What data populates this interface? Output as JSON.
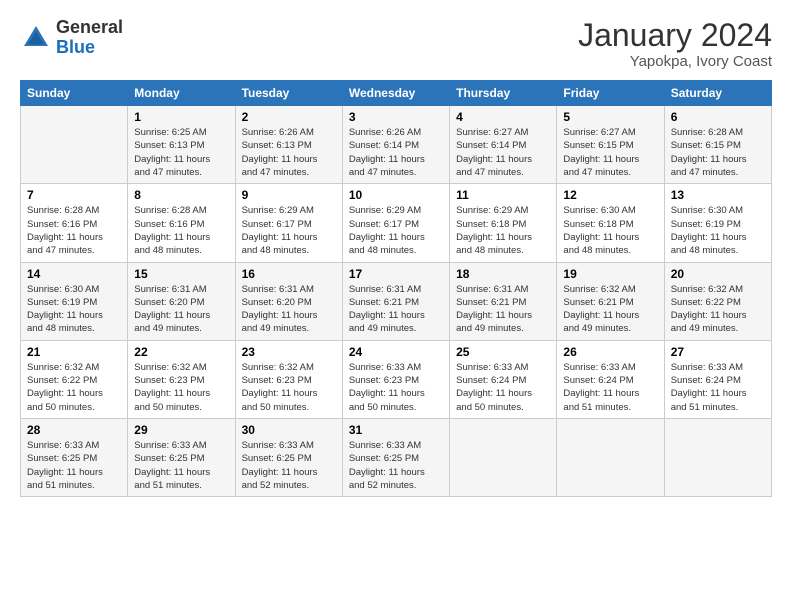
{
  "logo": {
    "line1": "General",
    "line2": "Blue"
  },
  "title": "January 2024",
  "subtitle": "Yapokpa, Ivory Coast",
  "weekdays": [
    "Sunday",
    "Monday",
    "Tuesday",
    "Wednesday",
    "Thursday",
    "Friday",
    "Saturday"
  ],
  "weeks": [
    [
      {
        "day": "",
        "sunrise": "",
        "sunset": "",
        "daylight": ""
      },
      {
        "day": "1",
        "sunrise": "Sunrise: 6:25 AM",
        "sunset": "Sunset: 6:13 PM",
        "daylight": "Daylight: 11 hours and 47 minutes."
      },
      {
        "day": "2",
        "sunrise": "Sunrise: 6:26 AM",
        "sunset": "Sunset: 6:13 PM",
        "daylight": "Daylight: 11 hours and 47 minutes."
      },
      {
        "day": "3",
        "sunrise": "Sunrise: 6:26 AM",
        "sunset": "Sunset: 6:14 PM",
        "daylight": "Daylight: 11 hours and 47 minutes."
      },
      {
        "day": "4",
        "sunrise": "Sunrise: 6:27 AM",
        "sunset": "Sunset: 6:14 PM",
        "daylight": "Daylight: 11 hours and 47 minutes."
      },
      {
        "day": "5",
        "sunrise": "Sunrise: 6:27 AM",
        "sunset": "Sunset: 6:15 PM",
        "daylight": "Daylight: 11 hours and 47 minutes."
      },
      {
        "day": "6",
        "sunrise": "Sunrise: 6:28 AM",
        "sunset": "Sunset: 6:15 PM",
        "daylight": "Daylight: 11 hours and 47 minutes."
      }
    ],
    [
      {
        "day": "7",
        "sunrise": "Sunrise: 6:28 AM",
        "sunset": "Sunset: 6:16 PM",
        "daylight": "Daylight: 11 hours and 47 minutes."
      },
      {
        "day": "8",
        "sunrise": "Sunrise: 6:28 AM",
        "sunset": "Sunset: 6:16 PM",
        "daylight": "Daylight: 11 hours and 48 minutes."
      },
      {
        "day": "9",
        "sunrise": "Sunrise: 6:29 AM",
        "sunset": "Sunset: 6:17 PM",
        "daylight": "Daylight: 11 hours and 48 minutes."
      },
      {
        "day": "10",
        "sunrise": "Sunrise: 6:29 AM",
        "sunset": "Sunset: 6:17 PM",
        "daylight": "Daylight: 11 hours and 48 minutes."
      },
      {
        "day": "11",
        "sunrise": "Sunrise: 6:29 AM",
        "sunset": "Sunset: 6:18 PM",
        "daylight": "Daylight: 11 hours and 48 minutes."
      },
      {
        "day": "12",
        "sunrise": "Sunrise: 6:30 AM",
        "sunset": "Sunset: 6:18 PM",
        "daylight": "Daylight: 11 hours and 48 minutes."
      },
      {
        "day": "13",
        "sunrise": "Sunrise: 6:30 AM",
        "sunset": "Sunset: 6:19 PM",
        "daylight": "Daylight: 11 hours and 48 minutes."
      }
    ],
    [
      {
        "day": "14",
        "sunrise": "Sunrise: 6:30 AM",
        "sunset": "Sunset: 6:19 PM",
        "daylight": "Daylight: 11 hours and 48 minutes."
      },
      {
        "day": "15",
        "sunrise": "Sunrise: 6:31 AM",
        "sunset": "Sunset: 6:20 PM",
        "daylight": "Daylight: 11 hours and 49 minutes."
      },
      {
        "day": "16",
        "sunrise": "Sunrise: 6:31 AM",
        "sunset": "Sunset: 6:20 PM",
        "daylight": "Daylight: 11 hours and 49 minutes."
      },
      {
        "day": "17",
        "sunrise": "Sunrise: 6:31 AM",
        "sunset": "Sunset: 6:21 PM",
        "daylight": "Daylight: 11 hours and 49 minutes."
      },
      {
        "day": "18",
        "sunrise": "Sunrise: 6:31 AM",
        "sunset": "Sunset: 6:21 PM",
        "daylight": "Daylight: 11 hours and 49 minutes."
      },
      {
        "day": "19",
        "sunrise": "Sunrise: 6:32 AM",
        "sunset": "Sunset: 6:21 PM",
        "daylight": "Daylight: 11 hours and 49 minutes."
      },
      {
        "day": "20",
        "sunrise": "Sunrise: 6:32 AM",
        "sunset": "Sunset: 6:22 PM",
        "daylight": "Daylight: 11 hours and 49 minutes."
      }
    ],
    [
      {
        "day": "21",
        "sunrise": "Sunrise: 6:32 AM",
        "sunset": "Sunset: 6:22 PM",
        "daylight": "Daylight: 11 hours and 50 minutes."
      },
      {
        "day": "22",
        "sunrise": "Sunrise: 6:32 AM",
        "sunset": "Sunset: 6:23 PM",
        "daylight": "Daylight: 11 hours and 50 minutes."
      },
      {
        "day": "23",
        "sunrise": "Sunrise: 6:32 AM",
        "sunset": "Sunset: 6:23 PM",
        "daylight": "Daylight: 11 hours and 50 minutes."
      },
      {
        "day": "24",
        "sunrise": "Sunrise: 6:33 AM",
        "sunset": "Sunset: 6:23 PM",
        "daylight": "Daylight: 11 hours and 50 minutes."
      },
      {
        "day": "25",
        "sunrise": "Sunrise: 6:33 AM",
        "sunset": "Sunset: 6:24 PM",
        "daylight": "Daylight: 11 hours and 50 minutes."
      },
      {
        "day": "26",
        "sunrise": "Sunrise: 6:33 AM",
        "sunset": "Sunset: 6:24 PM",
        "daylight": "Daylight: 11 hours and 51 minutes."
      },
      {
        "day": "27",
        "sunrise": "Sunrise: 6:33 AM",
        "sunset": "Sunset: 6:24 PM",
        "daylight": "Daylight: 11 hours and 51 minutes."
      }
    ],
    [
      {
        "day": "28",
        "sunrise": "Sunrise: 6:33 AM",
        "sunset": "Sunset: 6:25 PM",
        "daylight": "Daylight: 11 hours and 51 minutes."
      },
      {
        "day": "29",
        "sunrise": "Sunrise: 6:33 AM",
        "sunset": "Sunset: 6:25 PM",
        "daylight": "Daylight: 11 hours and 51 minutes."
      },
      {
        "day": "30",
        "sunrise": "Sunrise: 6:33 AM",
        "sunset": "Sunset: 6:25 PM",
        "daylight": "Daylight: 11 hours and 52 minutes."
      },
      {
        "day": "31",
        "sunrise": "Sunrise: 6:33 AM",
        "sunset": "Sunset: 6:25 PM",
        "daylight": "Daylight: 11 hours and 52 minutes."
      },
      {
        "day": "",
        "sunrise": "",
        "sunset": "",
        "daylight": ""
      },
      {
        "day": "",
        "sunrise": "",
        "sunset": "",
        "daylight": ""
      },
      {
        "day": "",
        "sunrise": "",
        "sunset": "",
        "daylight": ""
      }
    ]
  ]
}
